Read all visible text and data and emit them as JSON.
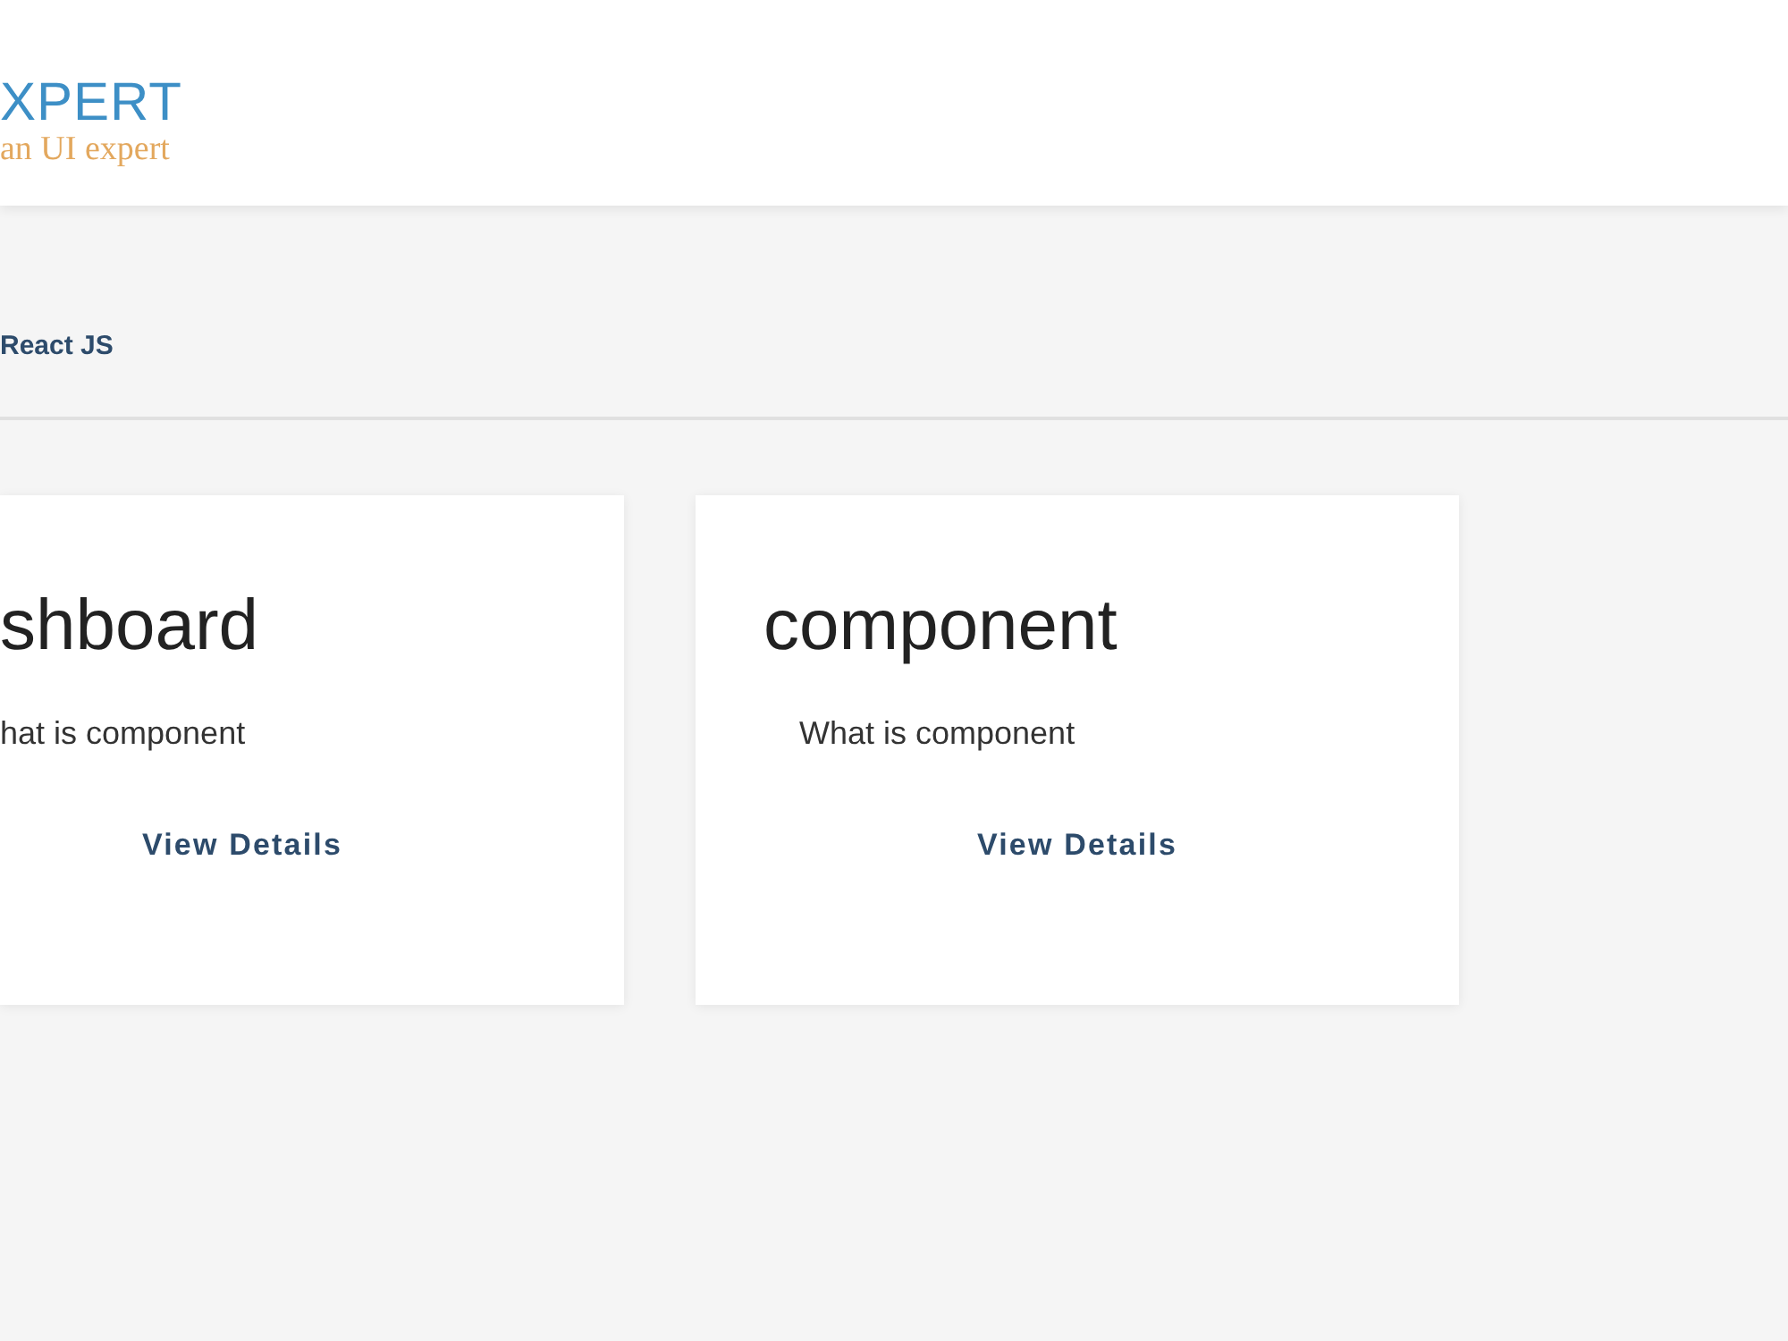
{
  "header": {
    "logo": {
      "wordmark": "XPERT",
      "tagline": "an UI expert"
    }
  },
  "breadcrumb": {
    "label": "React JS"
  },
  "cards": [
    {
      "title": "shboard",
      "description": "hat is component",
      "action": "View Details"
    },
    {
      "title": "component",
      "description": "What is component",
      "action": "View Details"
    }
  ]
}
